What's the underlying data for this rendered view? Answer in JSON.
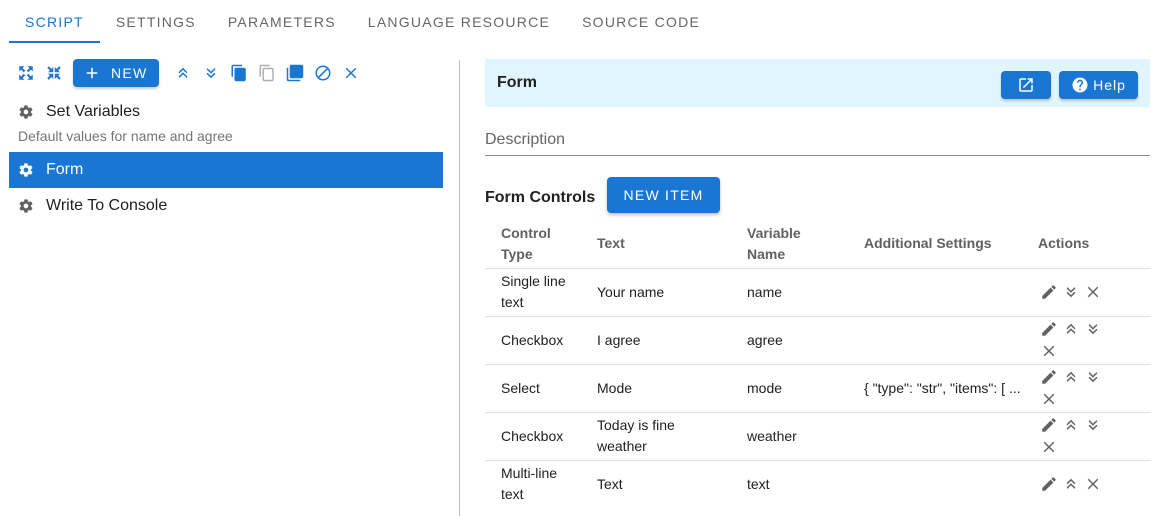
{
  "tabs": [
    "SCRIPT",
    "SETTINGS",
    "PARAMETERS",
    "LANGUAGE RESOURCE",
    "SOURCE CODE"
  ],
  "toolbar": {
    "new_label": "NEW"
  },
  "steps": [
    {
      "label": "Set Variables",
      "description": "Default values for name and agree"
    },
    {
      "label": "Form"
    },
    {
      "label": "Write To Console"
    }
  ],
  "panel": {
    "title": "Form",
    "help_label": "Help",
    "description_placeholder": "Description",
    "form_controls_label": "Form Controls",
    "new_item_label": "NEW ITEM"
  },
  "table": {
    "headers": [
      "Control Type",
      "Text",
      "Variable Name",
      "Additional Settings",
      "Actions"
    ],
    "rows": [
      {
        "type": "Single line text",
        "text": "Your name",
        "var": "name",
        "settings": ""
      },
      {
        "type": "Checkbox",
        "text": "I agree",
        "var": "agree",
        "settings": ""
      },
      {
        "type": "Select",
        "text": "Mode",
        "var": "mode",
        "settings": "{ \"type\": \"str\", \"items\": [ ..."
      },
      {
        "type": "Checkbox",
        "text": "Today is fine weather",
        "var": "weather",
        "settings": ""
      },
      {
        "type": "Multi-line text",
        "text": "Text",
        "var": "text",
        "settings": ""
      }
    ]
  },
  "colors": {
    "primary": "#1976d2",
    "header_bg": "#e1f5fe"
  }
}
